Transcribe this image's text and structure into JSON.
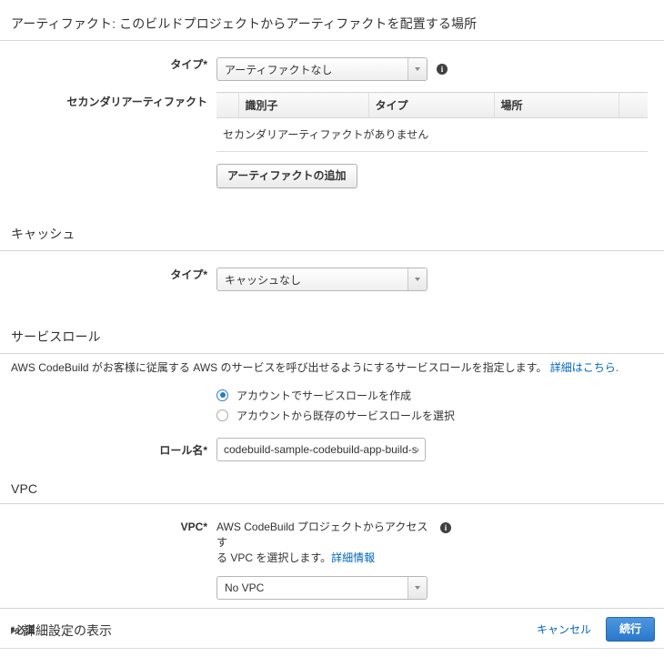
{
  "artifacts": {
    "section_title": "アーティファクト: このビルドプロジェクトからアーティファクトを配置する場所",
    "type_label": "タイプ*",
    "type_value": "アーティファクトなし",
    "type_info_icon": "info-icon",
    "secondary_label": "セカンダリアーティファクト",
    "table": {
      "columns": [
        "識別子",
        "タイプ",
        "場所"
      ],
      "empty_message": "セカンダリアーティファクトがありません"
    },
    "add_button": "アーティファクトの追加"
  },
  "cache": {
    "section_title": "キャッシュ",
    "type_label": "タイプ*",
    "type_value": "キャッシュなし"
  },
  "service_role": {
    "section_title": "サービスロール",
    "description": "AWS CodeBuild がお客様に従属する AWS のサービスを呼び出せるようにするサービスロールを指定します。",
    "description_link": "詳細はこちら.",
    "options": [
      {
        "label": "アカウントでサービスロールを作成",
        "selected": true
      },
      {
        "label": "アカウントから既存のサービスロールを選択",
        "selected": false
      }
    ],
    "role_name_label": "ロール名*",
    "role_name_value": "codebuild-sample-codebuild-app-build-se"
  },
  "vpc": {
    "section_title": "VPC",
    "field_label": "VPC*",
    "help_text_line1": "AWS CodeBuild プロジェクトからアクセスす",
    "help_text_line2": "る VPC を選択します。",
    "help_link": "詳細情報",
    "info_icon": "info-icon",
    "select_value": "No VPC"
  },
  "advanced": {
    "toggle_label": "詳細設定の表示",
    "toggle_icon": "triangle-right-icon"
  },
  "footer": {
    "required_note": "*必須",
    "cancel_label": "キャンセル",
    "continue_label": "続行"
  },
  "colors": {
    "link": "#0066c0",
    "primary_button": "#2a78cc",
    "radio_selected": "#1f7ec4",
    "rule": "#d5d5d5"
  }
}
